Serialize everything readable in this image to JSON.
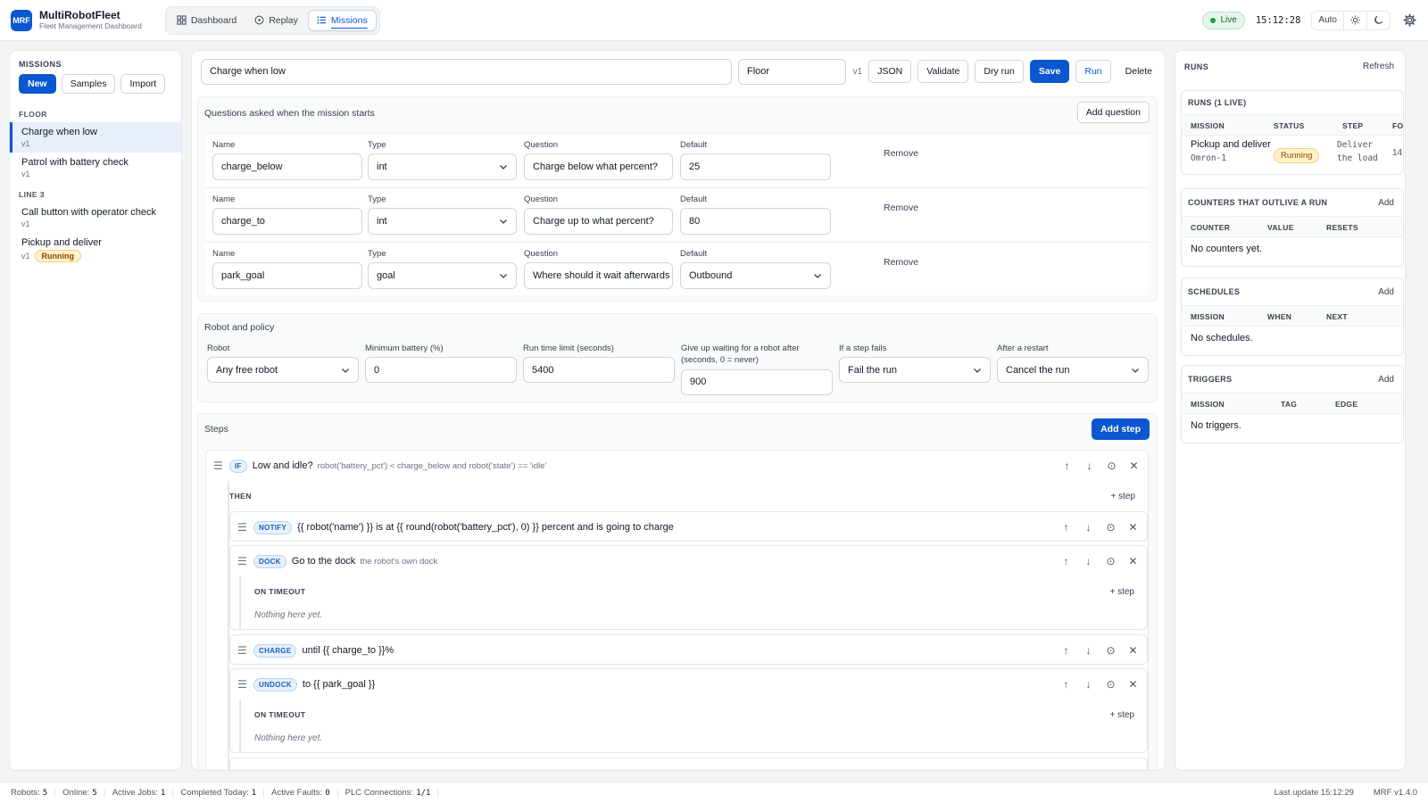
{
  "app": {
    "logo": "MRF",
    "name": "MultiRobotFleet",
    "subtitle": "Fleet Management Dashboard"
  },
  "nav": {
    "tabs": [
      {
        "label": "Dashboard"
      },
      {
        "label": "Replay"
      },
      {
        "label": "Missions"
      }
    ],
    "active": "Missions"
  },
  "header": {
    "live": "Live",
    "clock": "15:12:28",
    "theme_auto": "Auto"
  },
  "sidebar": {
    "title": "MISSIONS",
    "buttons": {
      "new": "New",
      "samples": "Samples",
      "import": "Import"
    },
    "groups": [
      {
        "label": "FLOOR",
        "items": [
          {
            "name": "Charge when low",
            "version": "v1"
          },
          {
            "name": "Patrol with battery check",
            "version": "v1"
          }
        ]
      },
      {
        "label": "LINE 3",
        "items": [
          {
            "name": "Call button with operator check",
            "version": "v1"
          },
          {
            "name": "Pickup and deliver",
            "version": "v1",
            "badge": "Running"
          }
        ]
      }
    ]
  },
  "editor": {
    "mission_name": "Charge when low",
    "group": "Floor",
    "version": "v1",
    "actions": {
      "json": "JSON",
      "validate": "Validate",
      "dry_run": "Dry run",
      "save": "Save",
      "run": "Run",
      "delete": "Delete"
    },
    "questions": {
      "title": "Questions asked when the mission starts",
      "add": "Add question",
      "labels": {
        "name": "Name",
        "type": "Type",
        "question": "Question",
        "default": "Default",
        "remove": "Remove"
      },
      "rows": [
        {
          "name": "charge_below",
          "type": "int",
          "question": "Charge below what percent?",
          "default": "25"
        },
        {
          "name": "charge_to",
          "type": "int",
          "question": "Charge up to what percent?",
          "default": "80"
        },
        {
          "name": "park_goal",
          "type": "goal",
          "question": "Where should it wait afterwards",
          "default": "Outbound"
        }
      ]
    },
    "policy": {
      "title": "Robot and policy",
      "robot_label": "Robot",
      "robot": "Any free robot",
      "min_battery_label": "Minimum battery (%)",
      "min_battery": "0",
      "time_limit_label": "Run time limit (seconds)",
      "time_limit": "5400",
      "give_up_label": "Give up waiting for a robot after (seconds, 0 = never)",
      "give_up": "900",
      "step_fails_label": "If a step fails",
      "step_fails": "Fail the run",
      "restart_label": "After a restart",
      "restart": "Cancel the run"
    },
    "steps": {
      "title": "Steps",
      "add": "Add step",
      "then_label": "THEN",
      "plus_step": "+ step",
      "on_timeout": "ON TIMEOUT",
      "nothing": "Nothing here yet.",
      "if": {
        "kind": "IF",
        "title": "Low and idle?",
        "expr": "robot('battery_pct') < charge_below and robot('state') == 'idle'"
      },
      "notify": {
        "kind": "NOTIFY",
        "title": "{{ robot('name') }} is at {{ round(robot('battery_pct'), 0) }} percent and is going to charge"
      },
      "dock": {
        "kind": "DOCK",
        "title": "Go to the dock",
        "sub": "the robot's own dock"
      },
      "charge": {
        "kind": "CHARGE",
        "title": "until {{ charge_to }}%"
      },
      "undock": {
        "kind": "UNDOCK",
        "title": "to {{ park_goal }}"
      }
    }
  },
  "right": {
    "title": "RUNS",
    "refresh": "Refresh",
    "runs": {
      "title": "RUNS (1 LIVE)",
      "columns": [
        "MISSION",
        "STATUS",
        "STEP",
        "FO"
      ],
      "row": {
        "mission": "Pickup and deliver",
        "robot": "Omron-1",
        "status": "Running",
        "step": "Deliver the load",
        "fo": "14"
      }
    },
    "counters": {
      "title": "COUNTERS THAT OUTLIVE A RUN",
      "add": "Add",
      "columns": [
        "COUNTER",
        "VALUE",
        "RESETS"
      ],
      "empty": "No counters yet."
    },
    "schedules": {
      "title": "SCHEDULES",
      "add": "Add",
      "columns": [
        "MISSION",
        "WHEN",
        "NEXT"
      ],
      "empty": "No schedules."
    },
    "triggers": {
      "title": "TRIGGERS",
      "add": "Add",
      "columns": [
        "MISSION",
        "TAG",
        "EDGE"
      ],
      "empty": "No triggers."
    }
  },
  "footer": {
    "stats": [
      {
        "label": "Robots:",
        "value": "5"
      },
      {
        "label": "Online:",
        "value": "5"
      },
      {
        "label": "Active Jobs:",
        "value": "1"
      },
      {
        "label": "Completed Today:",
        "value": "1"
      },
      {
        "label": "Active Faults:",
        "value": "0"
      },
      {
        "label": "PLC Connections:",
        "value": "1/1"
      }
    ],
    "last_update": "Last update 15:12:29",
    "version": "MRF v1.4.0"
  }
}
